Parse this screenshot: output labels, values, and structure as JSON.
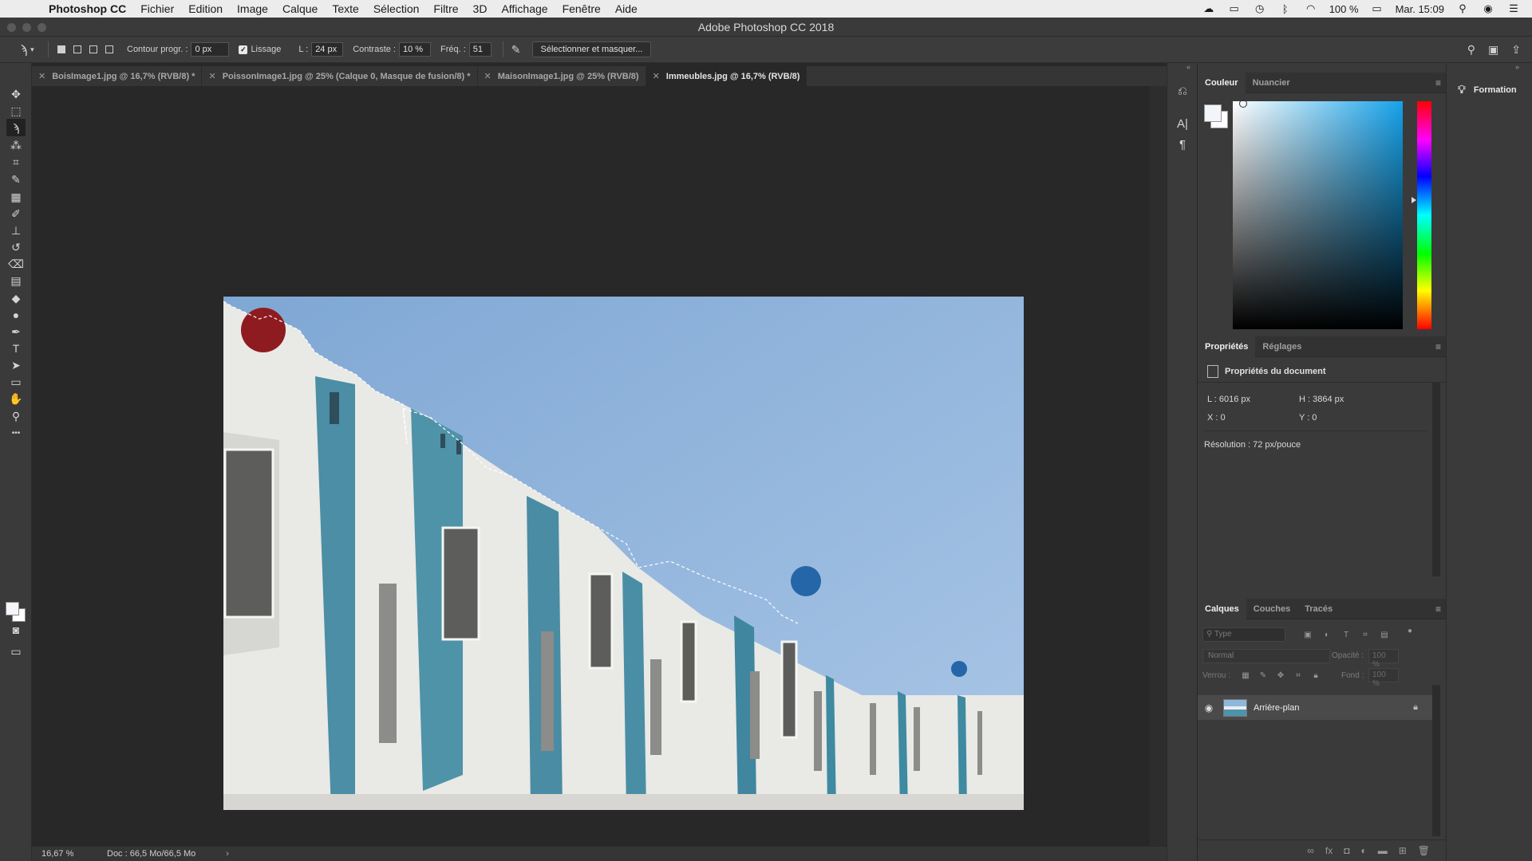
{
  "menubar": {
    "apple": "",
    "app": "Photoshop CC",
    "items": [
      "Fichier",
      "Edition",
      "Image",
      "Calque",
      "Texte",
      "Sélection",
      "Filtre",
      "3D",
      "Affichage",
      "Fenêtre",
      "Aide"
    ],
    "battery": "100 %",
    "clock": "Mar. 15:09"
  },
  "window": {
    "title": "Adobe Photoshop CC 2018"
  },
  "options": {
    "contour_label": "Contour progr. :",
    "contour_value": "0 px",
    "lissage_label": "Lissage",
    "width_label": "L :",
    "width_value": "24 px",
    "contrast_label": "Contraste :",
    "contrast_value": "10 %",
    "freq_label": "Fréq. :",
    "freq_value": "51",
    "select_mask_button": "Sélectionner et masquer..."
  },
  "tabs": [
    {
      "label": "BoisImage1.jpg @ 16,7% (RVB/8) *",
      "active": false
    },
    {
      "label": "PoissonImage1.jpg @ 25% (Calque 0, Masque de fusion/8) *",
      "active": false
    },
    {
      "label": "MaisonImage1.jpg @ 25% (RVB/8)",
      "active": false
    },
    {
      "label": "Immeubles.jpg @ 16,7% (RVB/8)",
      "active": true
    }
  ],
  "tools": [
    {
      "name": "move-tool",
      "icon": "✥",
      "selected": false
    },
    {
      "name": "marquee-tool",
      "icon": "⬚",
      "selected": false
    },
    {
      "name": "magnetic-lasso-tool",
      "icon": "ϡ",
      "selected": true
    },
    {
      "name": "magic-wand-tool",
      "icon": "⁂",
      "selected": false
    },
    {
      "name": "crop-tool",
      "icon": "⌗",
      "selected": false
    },
    {
      "name": "eyedropper-tool",
      "icon": "✎",
      "selected": false
    },
    {
      "name": "healing-tool",
      "icon": "▦",
      "selected": false
    },
    {
      "name": "brush-tool",
      "icon": "✐",
      "selected": false
    },
    {
      "name": "stamp-tool",
      "icon": "⊥",
      "selected": false
    },
    {
      "name": "history-brush-tool",
      "icon": "↺",
      "selected": false
    },
    {
      "name": "eraser-tool",
      "icon": "⌫",
      "selected": false
    },
    {
      "name": "gradient-tool",
      "icon": "▤",
      "selected": false
    },
    {
      "name": "blur-tool",
      "icon": "◆",
      "selected": false
    },
    {
      "name": "dodge-tool",
      "icon": "●",
      "selected": false
    },
    {
      "name": "pen-tool",
      "icon": "✒",
      "selected": false
    },
    {
      "name": "type-tool",
      "icon": "T",
      "selected": false
    },
    {
      "name": "path-selection-tool",
      "icon": "➤",
      "selected": false
    },
    {
      "name": "shape-tool",
      "icon": "▭",
      "selected": false
    },
    {
      "name": "hand-tool",
      "icon": "✋",
      "selected": false
    },
    {
      "name": "zoom-tool",
      "icon": "⚲",
      "selected": false
    },
    {
      "name": "more-tools",
      "icon": "•••",
      "selected": false
    }
  ],
  "status": {
    "zoom": "16,67 %",
    "doc": "Doc : 66,5 Mo/66,5 Mo",
    "arrow": "›"
  },
  "color_panel": {
    "tabs": [
      "Couleur",
      "Nuancier"
    ],
    "foreground": "#f2f6fa",
    "background": "#ffffff",
    "hue": "#16a2ea"
  },
  "props_panel": {
    "tabs": [
      "Propriétés",
      "Réglages"
    ],
    "header": "Propriétés du document",
    "width": "L : 6016 px",
    "height": "H : 3864 px",
    "x": "X : 0",
    "y": "Y : 0",
    "resolution": "Résolution : 72 px/pouce"
  },
  "layers_panel": {
    "tabs": [
      "Calques",
      "Couches",
      "Tracés"
    ],
    "type_placeholder": "Type",
    "blend_mode": "Normal",
    "opacity_label": "Opacité :",
    "opacity_value": "100 %",
    "lock_label": "Verrou :",
    "fill_label": "Fond :",
    "fill_value": "100 %",
    "layer_name": "Arrière-plan"
  },
  "learn_panel": {
    "label": "Formation"
  }
}
